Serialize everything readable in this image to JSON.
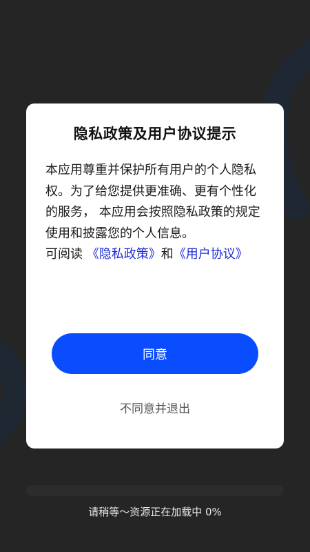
{
  "dialog": {
    "title": "隐私政策及用户协议提示",
    "body_text": "本应用尊重并保护所有用户的个人隐私权。为了给您提供更准确、更有个性化的服务， 本应用会按照隐私政策的规定使用和披露您的个人信息。",
    "read_prefix": "可阅读 ",
    "privacy_link": "《隐私政策》",
    "conjunction": "和",
    "agreement_link": "《用户协议》",
    "agree_label": "同意",
    "disagree_label": "不同意并退出"
  },
  "loading": {
    "text": "请稍等～资源正在加载中 0%",
    "progress_percent": 0
  },
  "colors": {
    "background": "#252525",
    "accent": "#0a4dff",
    "link": "#1c2bd6",
    "dialog_bg": "#ffffff"
  }
}
